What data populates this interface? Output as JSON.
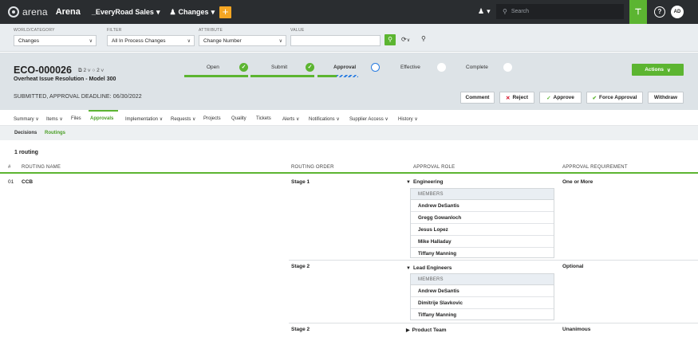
{
  "topbar": {
    "logo_text": "arena",
    "app_name": "Arena",
    "workspace": "_EveryRoad Sales",
    "changes_menu": "Changes",
    "plus": "+",
    "search_placeholder": "Search",
    "green_icon": "⊤",
    "help": "?",
    "avatar": "AD"
  },
  "filters": {
    "world_label": "WORLD/CATEGORY",
    "world_value": "Changes",
    "filter_label": "FILTER",
    "filter_value": "All In Process Changes",
    "attribute_label": "ATTRIBUTE",
    "attribute_value": "Change Number",
    "value_label": "VALUE",
    "value_value": ""
  },
  "header": {
    "number": "ECO-000026",
    "badges": "⧉ 2 ∨   ○ 2 ∨",
    "title": "Overheat Issue Resolution - Model 300",
    "deadline": "SUBMITTED, APPROVAL DEADLINE: 06/30/2022",
    "steps": [
      {
        "label": "Open",
        "state": "done"
      },
      {
        "label": "Submit",
        "state": "done"
      },
      {
        "label": "Approval",
        "state": "current"
      },
      {
        "label": "Effective",
        "state": "todo"
      },
      {
        "label": "Complete",
        "state": "todo"
      }
    ],
    "actions_label": "Actions",
    "buttons": {
      "comment": "Comment",
      "reject": "Reject",
      "approve": "Approve",
      "force_approve": "Force Approval",
      "withdraw": "Withdraw"
    }
  },
  "tabs": [
    "Summary ∨",
    "Items ∨",
    "Files",
    "Approvals",
    "Implementation ∨",
    "Requests ∨",
    "Projects",
    "Quality",
    "Tickets",
    "Alerts ∨",
    "Notifications ∨",
    "Supplier Access ∨",
    "History ∨"
  ],
  "subtabs": [
    "Decisions",
    "Routings"
  ],
  "routing_count": "1 routing",
  "table": {
    "headers": [
      "#",
      "ROUTING NAME",
      "ROUTING ORDER",
      "APPROVAL ROLE",
      "APPROVAL REQUIREMENT"
    ],
    "row_num": "01",
    "routing_name": "CCB",
    "stages": [
      {
        "order": "Stage 1",
        "role": "Engineering",
        "expanded": true,
        "requirement": "One or More",
        "members_header": "MEMBERS",
        "members": [
          "Andrew DeSantis",
          "Gregg Gowanloch",
          "Jesus Lopez",
          "Mike Halladay",
          "Tiffany Manning"
        ]
      },
      {
        "order": "Stage 2",
        "role": "Lead Engineers",
        "expanded": true,
        "requirement": "Optional",
        "members_header": "MEMBERS",
        "members": [
          "Andrew DeSantis",
          "Dimitrije Slavkovic",
          "Tiffany Manning"
        ]
      },
      {
        "order": "Stage 2",
        "role": "Product Team",
        "expanded": false,
        "requirement": "Unanimous"
      }
    ]
  },
  "colors": {
    "topbar_bg": "#2a2d30",
    "accent_green": "#5cb531",
    "plus_orange": "#f5a623",
    "approval_blue": "#2a7de1",
    "reject_red": "#d0021b"
  }
}
